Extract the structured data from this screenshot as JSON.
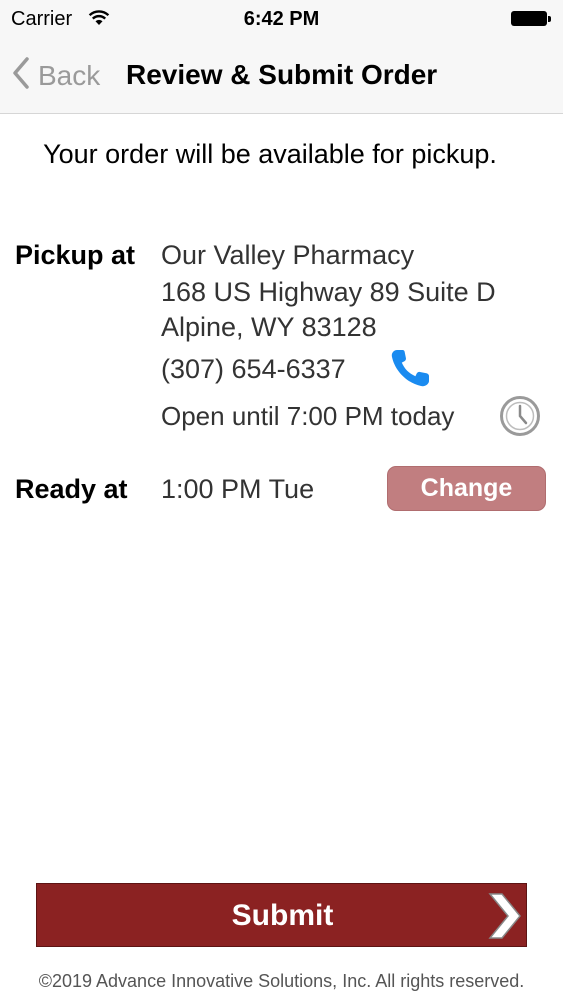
{
  "status_bar": {
    "carrier": "Carrier",
    "time": "6:42 PM"
  },
  "nav": {
    "back_label": "Back",
    "title": "Review & Submit Order"
  },
  "notice": "Your order will be available for pickup.",
  "pickup": {
    "label": "Pickup at",
    "pharmacy_name": "Our Valley Pharmacy",
    "address_line1": "168 US Highway 89 Suite D",
    "address_line2": "Alpine, WY 83128",
    "phone": "(307) 654-6337",
    "hours": "Open until 7:00 PM today"
  },
  "ready": {
    "label": "Ready at",
    "time": "1:00 PM Tue",
    "change_label": "Change"
  },
  "submit_label": "Submit",
  "copyright": "©2019 Advance Innovative Solutions, Inc. All rights reserved.",
  "colors": {
    "accent": "#8b2222",
    "change_button": "#c17e80",
    "phone_icon": "#1a8bf0"
  }
}
